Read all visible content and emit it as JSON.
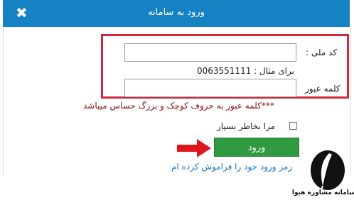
{
  "dialog": {
    "title": "ورود به سامانه",
    "close_glyph": "✖"
  },
  "form": {
    "national_id_label": "کد ملی :",
    "national_id_value": "",
    "example_text": "برای مثال : 0063551111",
    "password_label": "کلمه عبور",
    "password_value": "",
    "case_sensitive_note": "***کلمه عبور به حروف کوچک و بزرگ حساس میباشد",
    "remember_me_label": "مرا بخاطر بسپار",
    "login_button_label": "ورود",
    "forgot_password_link": "رمز ورود خود را فراموش کرده ام"
  },
  "watermark": {
    "caption": "سامانه مشاوره هیوا"
  },
  "colors": {
    "titlebar": "#1582c3",
    "highlight_box": "#cd2a3b",
    "login_button": "#2f9a42",
    "arrow": "#e0151b",
    "note_text": "#8b0f15",
    "link": "#1b74c0"
  }
}
